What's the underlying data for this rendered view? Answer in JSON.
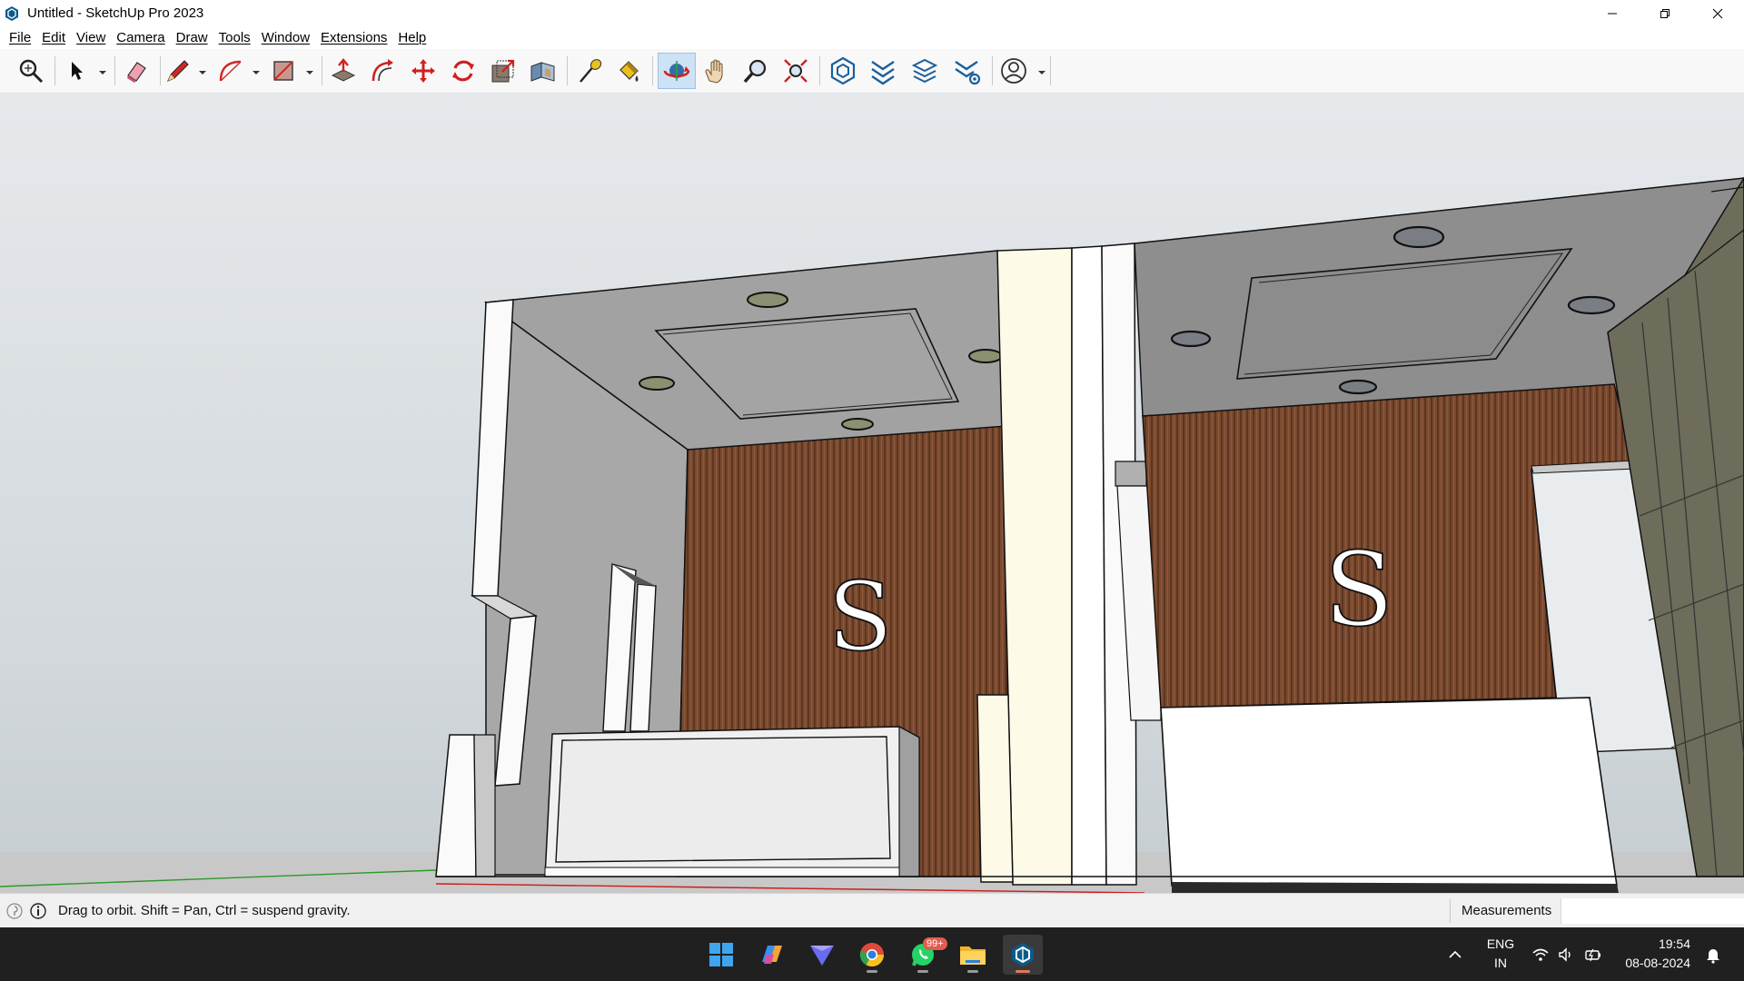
{
  "window": {
    "title": "Untitled - SketchUp Pro 2023"
  },
  "menu": [
    "File",
    "Edit",
    "View",
    "Camera",
    "Draw",
    "Tools",
    "Window",
    "Extensions",
    "Help"
  ],
  "toolbar": {
    "tools": [
      {
        "name": "zoom-extents",
        "icon": "magnifier-icon"
      },
      {
        "name": "select",
        "icon": "arrow-icon"
      },
      {
        "name": "eraser",
        "icon": "eraser-icon"
      },
      {
        "name": "line",
        "icon": "pencil-icon"
      },
      {
        "name": "arc",
        "icon": "arc-icon"
      },
      {
        "name": "rectangle",
        "icon": "rectangle-icon"
      },
      {
        "name": "push-pull",
        "icon": "pushpull-icon"
      },
      {
        "name": "offset",
        "icon": "offset-icon"
      },
      {
        "name": "move",
        "icon": "move-icon"
      },
      {
        "name": "rotate",
        "icon": "rotate-icon"
      },
      {
        "name": "scale",
        "icon": "scale-icon"
      },
      {
        "name": "follow-me",
        "icon": "followme-icon"
      },
      {
        "name": "tape-measure",
        "icon": "tape-icon"
      },
      {
        "name": "paint-bucket",
        "icon": "paint-icon"
      },
      {
        "name": "orbit",
        "icon": "orbit-icon",
        "active": true
      },
      {
        "name": "pan",
        "icon": "hand-icon"
      },
      {
        "name": "zoom",
        "icon": "zoom-icon"
      },
      {
        "name": "zoom-window",
        "icon": "zoom-extents-icon"
      },
      {
        "name": "3d-warehouse",
        "icon": "warehouse-icon"
      },
      {
        "name": "extension-warehouse",
        "icon": "extension-icon"
      },
      {
        "name": "layout",
        "icon": "layout-icon"
      },
      {
        "name": "extension-manager",
        "icon": "ext-manager-icon"
      },
      {
        "name": "account",
        "icon": "user-icon"
      }
    ]
  },
  "model": {
    "letter_left": "S",
    "letter_right": "S"
  },
  "status": {
    "hint": "Drag to orbit. Shift = Pan, Ctrl = suspend gravity.",
    "measurements_label": "Measurements",
    "measurements_value": ""
  },
  "taskbar": {
    "apps": [
      "start",
      "copilot",
      "vpn",
      "chrome",
      "whatsapp",
      "file-explorer",
      "sketchup"
    ],
    "whatsapp_badge": "99+",
    "language": "ENG",
    "region": "IN",
    "time": "19:54",
    "date": "08-08-2024"
  },
  "colors": {
    "accent_active_tool": "#cde2f4",
    "wood": "#7a4a30",
    "wall_grey": "#a9a9a9",
    "ceiling_grey": "#8e8e8e",
    "taskbar": "#202020"
  }
}
